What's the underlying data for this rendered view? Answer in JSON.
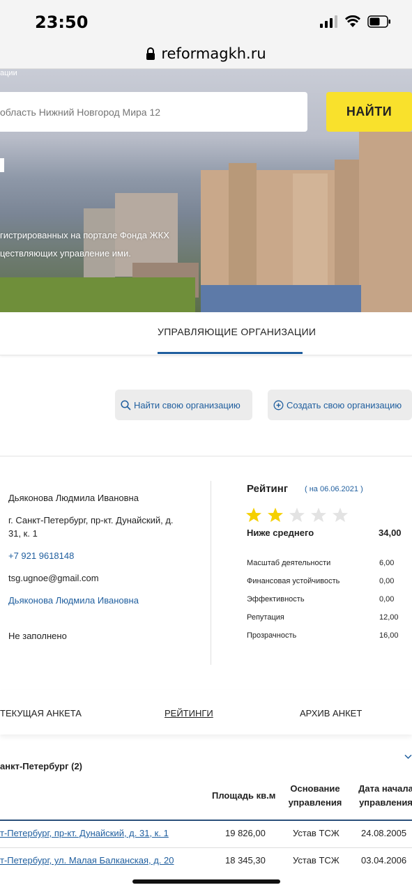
{
  "status": {
    "time": "23:50"
  },
  "browser": {
    "url": "reformagkh.ru"
  },
  "hero": {
    "top_text": "ации",
    "search_placeholder": "область Нижний Новгород Мира 12",
    "search_button": "НАЙТИ",
    "desc_line1": "гистрированных на портале Фонда ЖКХ",
    "desc_line2": "цествляющих управление ими."
  },
  "tabs": {
    "active": "УПРАВЛЯЮЩИЕ ОРГАНИЗАЦИИ"
  },
  "actions": {
    "find": "Найти свою организацию",
    "create": "Создать свою организацию"
  },
  "org": {
    "name": "Дьяконова Людмила Ивановна",
    "address_line1": "г. Санкт-Петербург, пр-кт. Дунайский, д.",
    "address_line2": "31, к. 1",
    "phone": "+7 921 9618148",
    "email": "tsg.ugnoe@gmail.com",
    "head": "Дьяконова Людмила Ивановна",
    "extra": "Не заполнено"
  },
  "rating": {
    "title": "Рейтинг",
    "date": "( на 06.06.2021 )",
    "stars_filled": 2,
    "stars_total": 5,
    "star_color": "#f5d000",
    "star_empty_color": "#e3e3e3",
    "grade": "Ниже среднего",
    "score": "34,00",
    "metrics": [
      {
        "label": "Масштаб деятельности",
        "value": "6,00"
      },
      {
        "label": "Финансовая устойчивость",
        "value": "0,00"
      },
      {
        "label": "Эффективность",
        "value": "0,00"
      },
      {
        "label": "Репутация",
        "value": "12,00"
      },
      {
        "label": "Прозрачность",
        "value": "16,00"
      }
    ]
  },
  "bottom_tabs": {
    "current": "ТЕКУЩАЯ АНКЕТА",
    "ratings": "РЕЙТИНГИ",
    "archive": "АРХИВ АНКЕТ"
  },
  "table": {
    "group": "анкт-Петербург (2)",
    "headers": {
      "area": "Площадь кв.м",
      "basis_1": "Основание",
      "basis_2": "управления",
      "date_1": "Дата начала",
      "date_2": "управления"
    },
    "rows": [
      {
        "address": "т-Петербург, пр-кт. Дунайский, д. 31, к. 1",
        "area": "19 826,00",
        "basis": "Устав ТСЖ",
        "date": "24.08.2005"
      },
      {
        "address": "т-Петербург, ул. Малая Балканская, д. 20",
        "area": "18 345,30",
        "basis": "Устав ТСЖ",
        "date": "03.04.2006"
      }
    ]
  },
  "colors": {
    "accent": "#1f5e9e",
    "button_yellow": "#f9e12c"
  }
}
